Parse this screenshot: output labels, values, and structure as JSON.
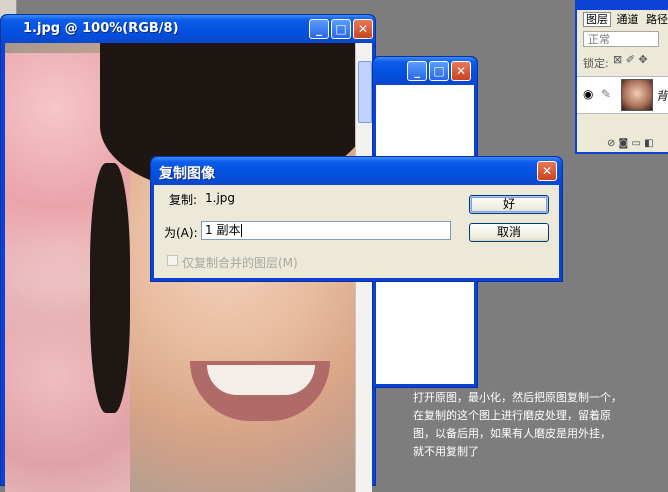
{
  "image_window": {
    "title": "1.jpg @ 100%(RGB/8)",
    "buttons": {
      "minimize": "_",
      "maximize": "□",
      "close": "✕"
    }
  },
  "second_window": {
    "buttons": {
      "minimize": "_",
      "maximize": "□",
      "close": "✕"
    }
  },
  "layers_palette": {
    "tabs": [
      "图层",
      "通道",
      "路径"
    ],
    "blend_mode": "正常",
    "lock_label": "锁定:",
    "layer_name_partial": "背"
  },
  "dialog": {
    "title": "复制图像",
    "source_label": "复制:",
    "source_value": "1.jpg",
    "as_label": "为(A):",
    "as_value": "1 副本",
    "checkbox_label": "仅复制合并的图层(M)",
    "ok_label": "好",
    "cancel_label": "取消",
    "close_glyph": "✕"
  },
  "toolbar": {
    "icons": [
      "move-icon",
      "lasso-icon",
      "magic-wand-icon",
      "brush-icon",
      "stamp-icon",
      "eraser-icon",
      "gradient-icon",
      "type-icon",
      "shape-icon",
      "eyedropper-icon",
      "zoom-icon"
    ]
  },
  "instruction_note": {
    "line1": "打开原图，最小化，然后把原图复制一个，",
    "line2": "在复制的这个图上进行磨皮处理，留着原",
    "line3": "图，以备后用，如果有人磨皮是用外挂，",
    "line4": "就不用复制了"
  },
  "colors": {
    "titlebar_blue": "#0c5cea",
    "dialog_face": "#ece9d8",
    "workspace_gray": "#7d7d7d",
    "close_red": "#c9421f"
  }
}
